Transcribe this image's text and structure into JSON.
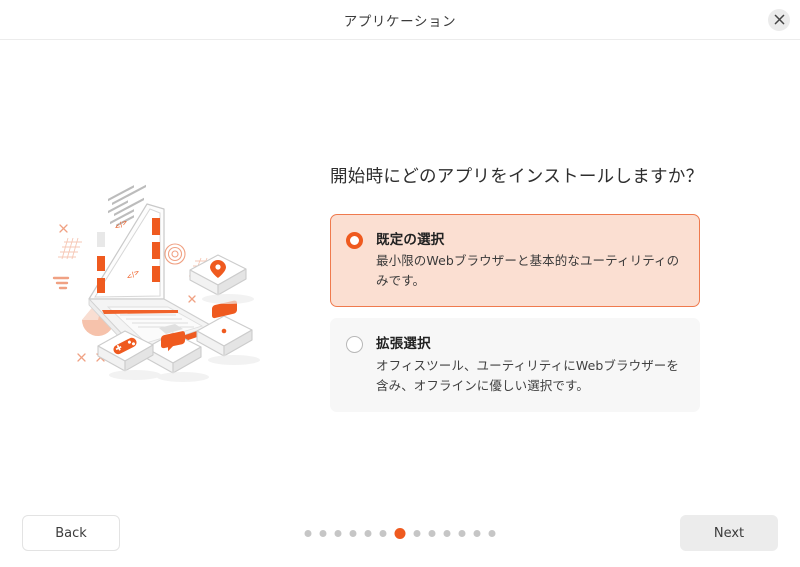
{
  "window": {
    "title": "アプリケーション",
    "close_icon": "close-icon"
  },
  "main": {
    "heading": "開始時にどのアプリをインストールしますか？",
    "options": [
      {
        "title": "既定の選択",
        "description": "最小限のWebブラウザーと基本的なユーティリティのみです。",
        "selected": true
      },
      {
        "title": "拡張選択",
        "description": "オフィスツール、ユーティリティにWebブラウザーを含み、オフラインに優しい選択です。",
        "selected": false
      }
    ]
  },
  "illustration": {
    "name": "isometric-laptop-apps-illustration",
    "elements": [
      "laptop-with-code-screen",
      "location-pin-app-cube",
      "camera-app-cube",
      "chat-app-cube",
      "game-controller-app-cube",
      "pie-chart-decoration",
      "concentric-circles-decoration",
      "grid-decorations",
      "x-mark-decorations"
    ]
  },
  "footer": {
    "back_label": "Back",
    "next_label": "Next",
    "dots_total": 13,
    "dots_active_index": 6
  },
  "colors": {
    "accent": "#ef5a1f",
    "accent_soft": "#ef7a4e",
    "selected_card_bg": "#fbdfd2",
    "unselected_card_bg": "#f7f7f7",
    "dot_inactive": "#c6c6c6",
    "next_button_bg": "#ececec"
  }
}
